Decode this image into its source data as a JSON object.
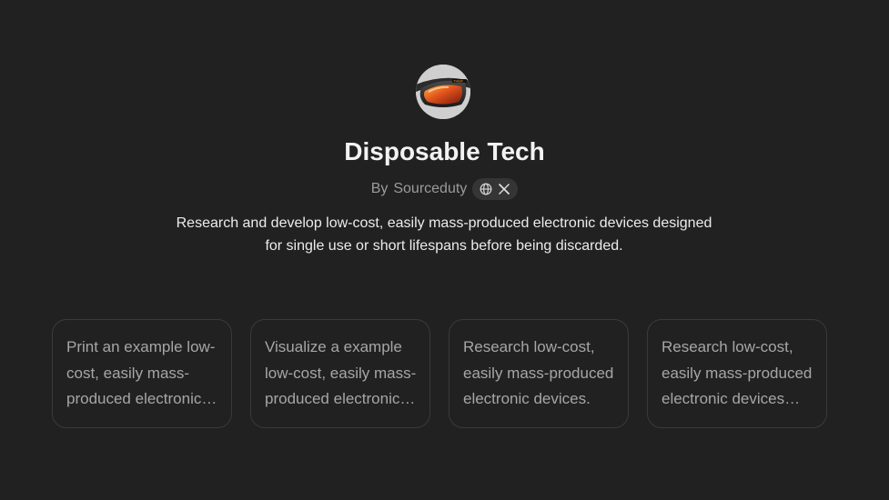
{
  "gpt": {
    "title": "Disposable Tech",
    "author_prefix": "By",
    "author": "Sourceduty",
    "description": "Research and develop low-cost, easily mass-produced electronic devices designed for single use or short lifespans before being discarded.",
    "avatar_icon": "ski-goggles-image",
    "social_icons": [
      "globe-icon",
      "x-icon"
    ]
  },
  "conversation_starters": [
    {
      "text": "Print an example low-cost, easily mass-produced electronic device."
    },
    {
      "text": "Visualize a example low-cost, easily mass-produced electronic device."
    },
    {
      "text": "Research low-cost, easily mass-produced electronic devices."
    },
    {
      "text": "Research low-cost, easily mass-produced electronic devices designed for single use."
    }
  ],
  "colors": {
    "background": "#212121",
    "card_border": "#3a3a3a",
    "muted_text": "#9b9b9b",
    "pill_bg": "#353535"
  }
}
